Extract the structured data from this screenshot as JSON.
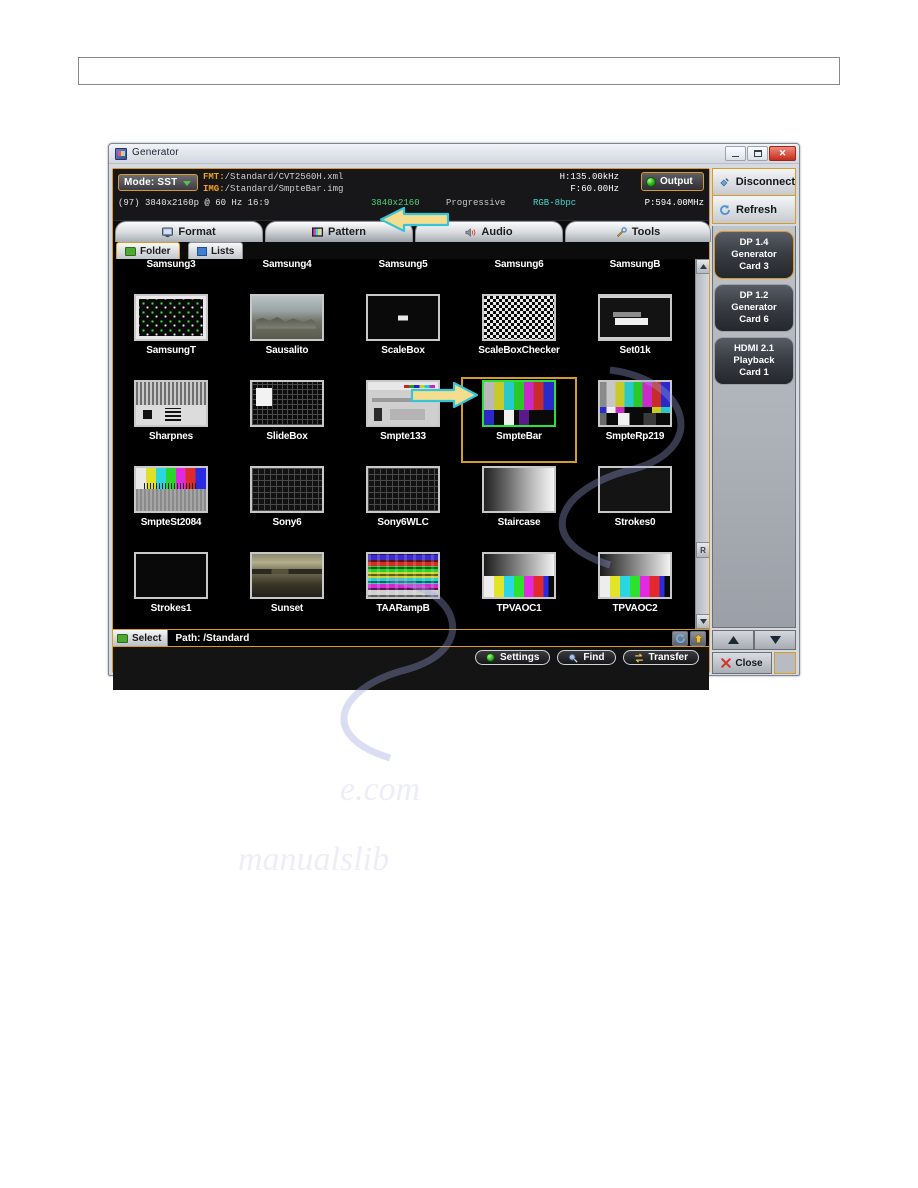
{
  "window": {
    "title": "Generator",
    "title_icon": "generator-app-icon",
    "controls": {
      "minimize": "minimize",
      "maximize": "maximize",
      "close": "close"
    }
  },
  "info_header": {
    "mode_button": {
      "label": "Mode: SST",
      "icon": "chevron-down-icon"
    },
    "fmt_label": "FMT:",
    "fmt_value": "/Standard/CVT2560H.xml",
    "img_label": "IMG:",
    "img_value": "/Standard/SmpteBar.img",
    "resolution_line": "(97)  3840x2160p @ 60 Hz 16:9",
    "resolution_green": "3840x2160",
    "scan_mode": "Progressive",
    "color_format": "RGB-8bpc",
    "h_freq": "H:135.00kHz",
    "v_freq": "F:60.00Hz",
    "pixel_clock": "P:594.00MHz",
    "output_button": {
      "label": "Output",
      "led_color": "#27b314"
    }
  },
  "tabs": [
    {
      "label": "Format",
      "icon": "monitor-icon",
      "active": false
    },
    {
      "label": "Pattern",
      "icon": "pattern-icon",
      "active": true
    },
    {
      "label": "Audio",
      "icon": "speaker-icon",
      "active": false
    },
    {
      "label": "Tools",
      "icon": "tools-icon",
      "active": false
    }
  ],
  "sub_tabs": [
    {
      "label": "Folder",
      "icon": "folder-icon",
      "active": true
    },
    {
      "label": "Lists",
      "icon": "list-icon",
      "active": false
    }
  ],
  "pattern_grid": {
    "rows": [
      [
        {
          "name": "Samsung3",
          "art": "clipped",
          "selected": false
        },
        {
          "name": "Samsung4",
          "art": "clipped",
          "selected": false
        },
        {
          "name": "Samsung5",
          "art": "clipped",
          "selected": false
        },
        {
          "name": "Samsung6",
          "art": "clipped",
          "selected": false
        },
        {
          "name": "SamsungB",
          "art": "clipped",
          "selected": false
        }
      ],
      [
        {
          "name": "SamsungT",
          "art": "samsungt",
          "selected": false
        },
        {
          "name": "Sausalito",
          "art": "sausalito",
          "selected": false
        },
        {
          "name": "ScaleBox",
          "art": "scalebox",
          "selected": false
        },
        {
          "name": "ScaleBoxChecker",
          "art": "checker",
          "selected": false
        },
        {
          "name": "Set01k",
          "art": "set01k",
          "selected": false
        }
      ],
      [
        {
          "name": "Sharpnes",
          "art": "sharpnes",
          "selected": false
        },
        {
          "name": "SlideBox",
          "art": "slidebox",
          "selected": false
        },
        {
          "name": "Smpte133",
          "art": "smpte133",
          "selected": false
        },
        {
          "name": "SmpteBar",
          "art": "smptebar",
          "selected": true
        },
        {
          "name": "SmpteRp219",
          "art": "rp219",
          "selected": false
        }
      ],
      [
        {
          "name": "SmpteSt2084",
          "art": "smptest2084",
          "selected": false
        },
        {
          "name": "Sony6",
          "art": "sony6",
          "selected": false
        },
        {
          "name": "Sony6WLC",
          "art": "sony6",
          "selected": false
        },
        {
          "name": "Staircase",
          "art": "staircase",
          "selected": false
        },
        {
          "name": "Strokes0",
          "art": "strokes0",
          "selected": false
        }
      ],
      [
        {
          "name": "Strokes1",
          "art": "strokes1",
          "selected": false
        },
        {
          "name": "Sunset",
          "art": "sunset",
          "selected": false
        },
        {
          "name": "TAARampB",
          "art": "taarampb",
          "selected": false
        },
        {
          "name": "TPVAOC1",
          "art": "tpvaoc",
          "selected": false
        },
        {
          "name": "TPVAOC2",
          "art": "tpvaoc",
          "selected": false
        }
      ]
    ]
  },
  "path_bar": {
    "select_button": {
      "label": "Select",
      "icon": "folder-icon"
    },
    "path_label": "Path: /Standard",
    "icons": [
      "refresh-icon",
      "up-folder-icon"
    ]
  },
  "action_bar": {
    "buttons": [
      {
        "label": "Settings",
        "icon": "gear-icon"
      },
      {
        "label": "Find",
        "icon": "magnifier-icon"
      },
      {
        "label": "Transfer",
        "icon": "transfer-icon"
      }
    ]
  },
  "side_panel": {
    "top_buttons": [
      {
        "label": "Disconnect",
        "icon": "disconnect-icon"
      },
      {
        "label": "Refresh",
        "icon": "refresh-icon"
      }
    ],
    "cards": [
      {
        "line1": "DP 1.4",
        "line2": "Generator",
        "line3": "Card 3",
        "active": true
      },
      {
        "line1": "DP 1.2",
        "line2": "Generator",
        "line3": "Card 6",
        "active": false
      },
      {
        "line1": "HDMI 2.1",
        "line2": "Playback",
        "line3": "Card 1",
        "active": false
      }
    ],
    "nav": [
      {
        "icon": "chevron-up-icon"
      },
      {
        "icon": "chevron-down-icon"
      }
    ],
    "close_button": {
      "label": "Close",
      "icon": "close-x-icon"
    }
  },
  "annotations": {
    "tab_arrow": "left-pointing-arrow-at-pattern-tab",
    "thumb_arrow": "right-pointing-arrow-at-smptebar"
  },
  "scrollbar": {
    "up": "scroll-up-arrow",
    "down": "scroll-down-arrow",
    "thumb": "scroll-thumb"
  },
  "colors": {
    "accent_orange": "#d79b2a",
    "arrow_fill": "#f5dd8e",
    "arrow_stroke": "#35c5d8",
    "selection_green": "#2ee13a"
  }
}
